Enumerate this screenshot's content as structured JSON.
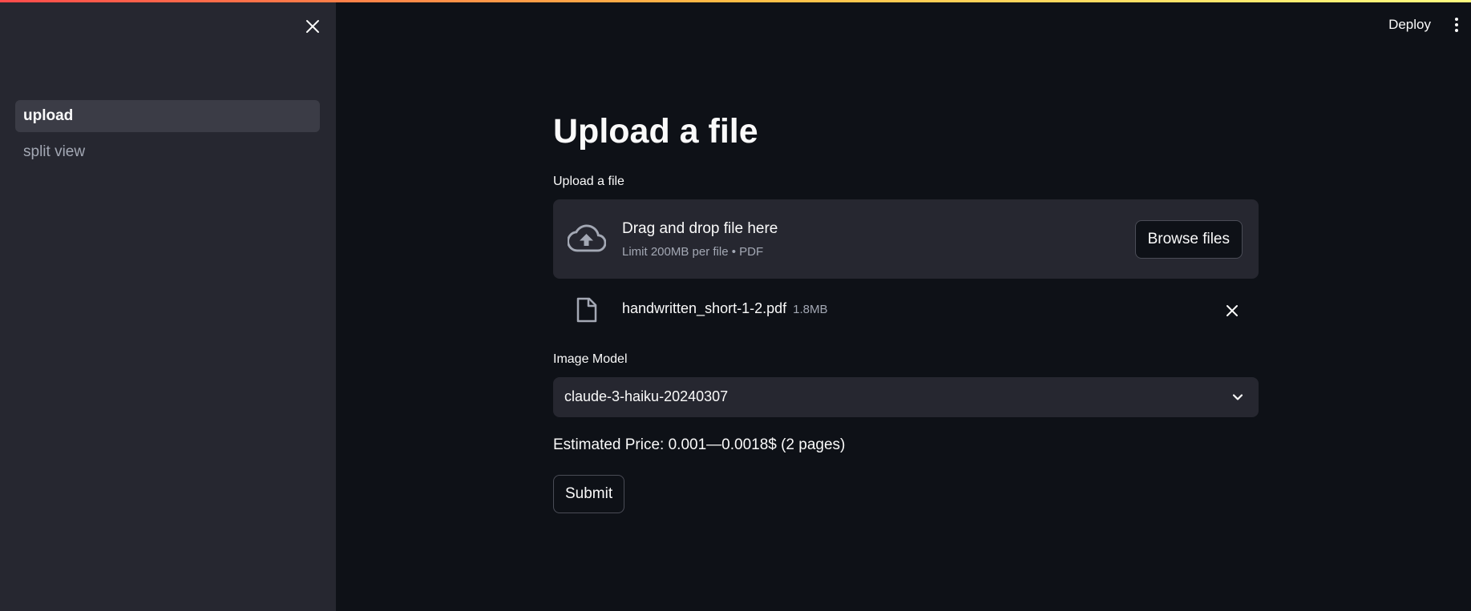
{
  "colors": {
    "background": "#0e1117",
    "sidebar": "#262730",
    "accent_gradient": [
      "#ff4b4b",
      "#ffbd45",
      "#fffd80"
    ]
  },
  "sidebar": {
    "close_icon": "close-icon",
    "items": [
      {
        "label": "upload",
        "active": true
      },
      {
        "label": "split view",
        "active": false
      }
    ]
  },
  "header": {
    "deploy_label": "Deploy",
    "menu_icon": "kebab-menu-icon"
  },
  "main": {
    "title": "Upload a file",
    "uploader": {
      "label": "Upload a file",
      "icon": "cloud-upload-icon",
      "title": "Drag and drop file here",
      "subtitle": "Limit 200MB per file • PDF",
      "browse_label": "Browse files"
    },
    "uploaded_file": {
      "icon": "file-icon",
      "name": "handwritten_short-1-2.pdf",
      "size": "1.8MB",
      "remove_icon": "close-icon"
    },
    "model_select": {
      "label": "Image Model",
      "value": "claude-3-haiku-20240307",
      "icon": "chevron-down-icon"
    },
    "price_text": "Estimated Price: 0.001—0.0018$ (2 pages)",
    "submit_label": "Submit"
  }
}
